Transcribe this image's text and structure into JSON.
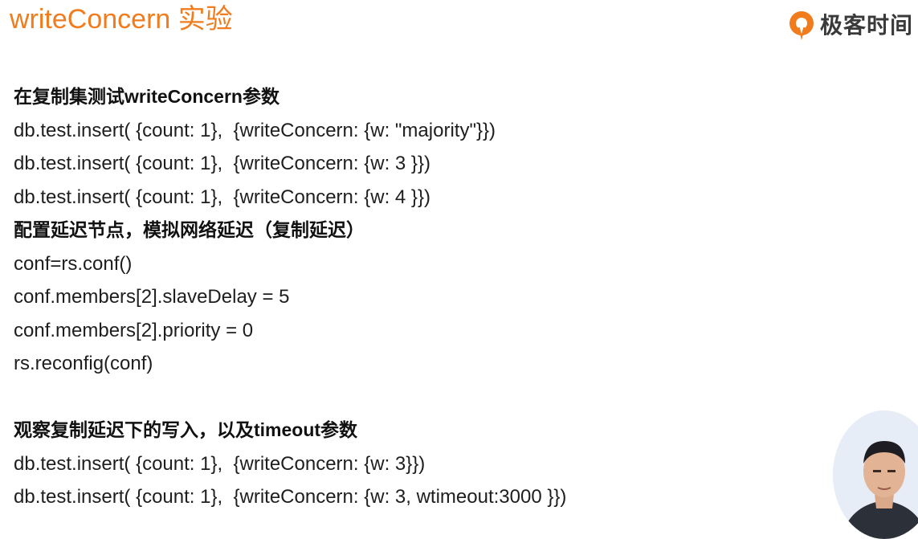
{
  "slide": {
    "title": "writeConcern 实验"
  },
  "brand": {
    "name": "极客时间",
    "logo_icon": "geektime-logo-icon",
    "accent_color": "#f07c1e"
  },
  "lines": [
    {
      "kind": "heading",
      "text": "在复制集测试writeConcern参数"
    },
    {
      "kind": "code",
      "text": "db.test.insert( {count: 1},  {writeConcern: {w: \"majority\"}})"
    },
    {
      "kind": "code",
      "text": "db.test.insert( {count: 1},  {writeConcern: {w: 3 }})"
    },
    {
      "kind": "code",
      "text": "db.test.insert( {count: 1},  {writeConcern: {w: 4 }})"
    },
    {
      "kind": "heading",
      "text": "配置延迟节点，模拟网络延迟（复制延迟）"
    },
    {
      "kind": "code",
      "text": "conf=rs.conf()"
    },
    {
      "kind": "code",
      "text": "conf.members[2].slaveDelay = 5"
    },
    {
      "kind": "code",
      "text": "conf.members[2].priority = 0"
    },
    {
      "kind": "code",
      "text": "rs.reconfig(conf)"
    },
    {
      "kind": "blank",
      "text": ""
    },
    {
      "kind": "heading",
      "text": "观察复制延迟下的写入，以及timeout参数"
    },
    {
      "kind": "code",
      "text": "db.test.insert( {count: 1},  {writeConcern: {w: 3}})"
    },
    {
      "kind": "code",
      "text": "db.test.insert( {count: 1},  {writeConcern: {w: 3, wtimeout:3000 }})"
    }
  ],
  "presenter": {
    "icon": "presenter-webcam-icon"
  }
}
